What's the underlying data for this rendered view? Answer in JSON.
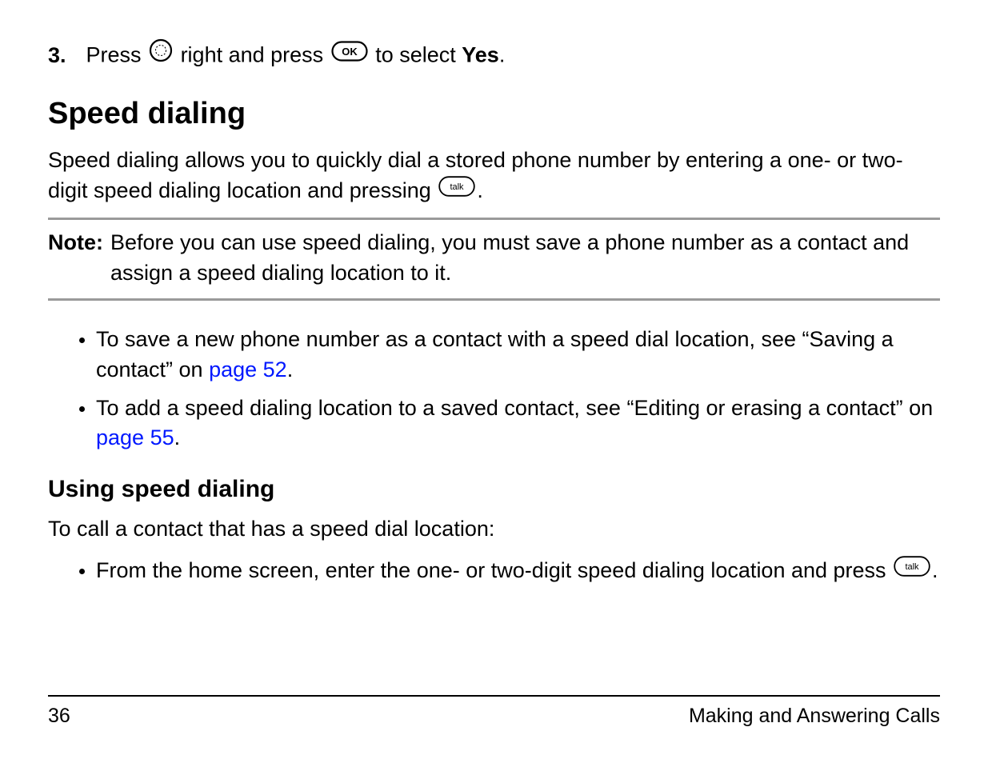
{
  "step": {
    "number": "3.",
    "part1": "Press ",
    "part2": " right and press ",
    "part3": " to select ",
    "yes": "Yes",
    "period": "."
  },
  "heading1": "Speed dialing",
  "intro": {
    "part1": "Speed dialing allows you to quickly dial a stored phone number by entering a one- or two-digit speed dialing location and pressing ",
    "period": "."
  },
  "note": {
    "label": "Note:",
    "text": "Before you can use speed dialing, you must save a phone number as a contact and assign a speed dialing location to it."
  },
  "bullets1": [
    {
      "pre": "To save a new phone number as a contact with a speed dial location, see “Saving a contact” on ",
      "link": "page 52",
      "post": "."
    },
    {
      "pre": "To add a speed dialing location to a saved contact, see “Editing or erasing a contact” on ",
      "link": "page 55",
      "post": "."
    }
  ],
  "heading2": "Using speed dialing",
  "para2": "To call a contact that has a speed dial location:",
  "bullets2": [
    {
      "pre": "From the home screen, enter the one- or two-digit speed dialing location and press ",
      "post": "."
    }
  ],
  "footer": {
    "page": "36",
    "title": "Making and Answering Calls"
  },
  "icons": {
    "nav": "nav-circle-icon",
    "ok": "ok-button-icon",
    "talk": "talk-button-icon"
  }
}
